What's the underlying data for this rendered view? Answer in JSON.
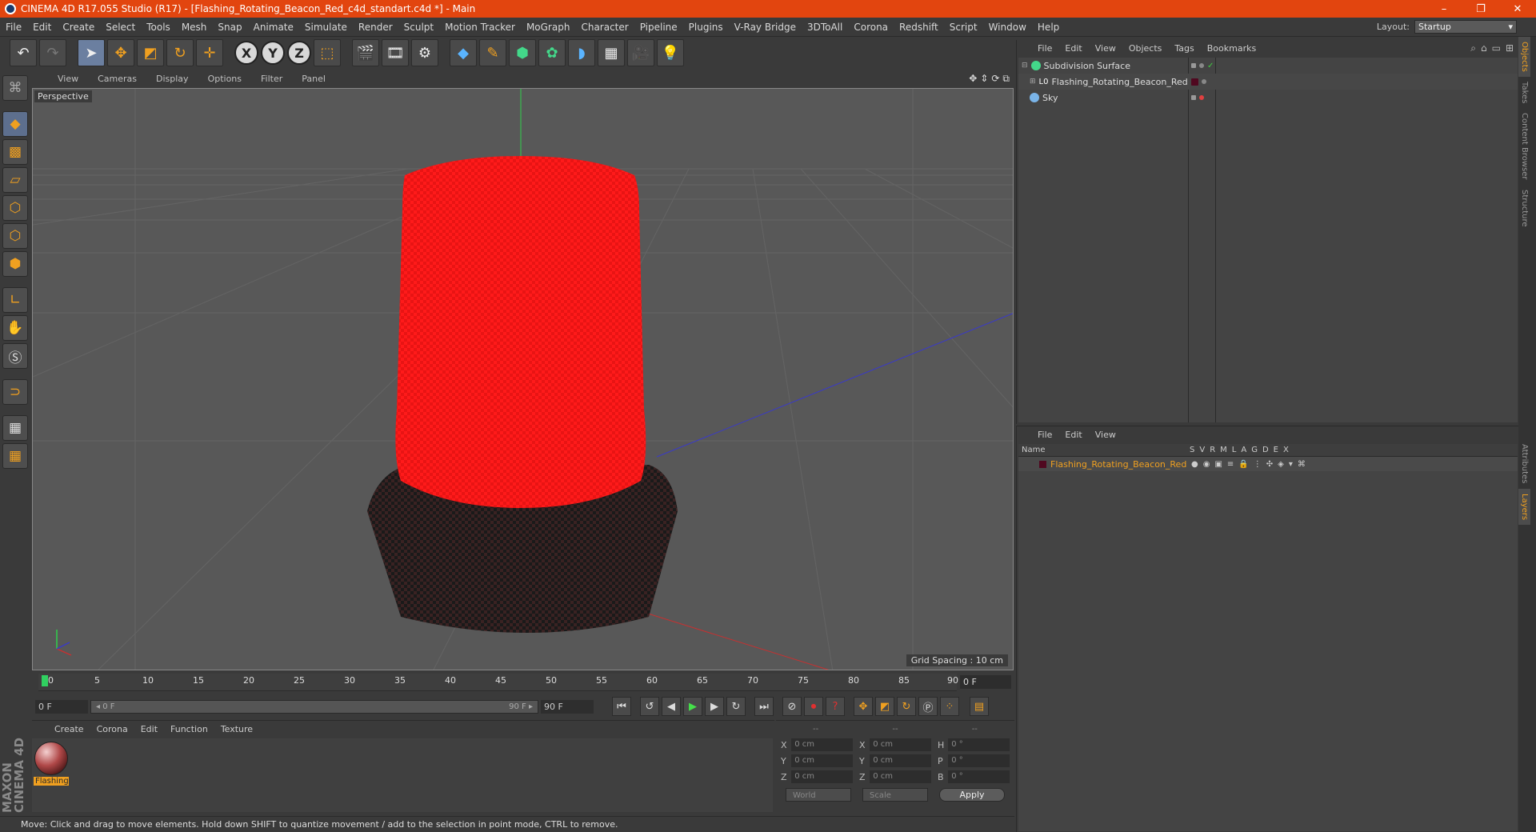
{
  "window": {
    "title": "CINEMA 4D R17.055 Studio (R17) - [Flashing_Rotating_Beacon_Red_c4d_standart.c4d *] - Main",
    "min": "–",
    "restore": "❐",
    "close": "✕"
  },
  "menu": [
    "File",
    "Edit",
    "Create",
    "Select",
    "Tools",
    "Mesh",
    "Snap",
    "Animate",
    "Simulate",
    "Render",
    "Sculpt",
    "Motion Tracker",
    "MoGraph",
    "Character",
    "Pipeline",
    "Plugins",
    "V-Ray Bridge",
    "3DToAll",
    "Corona",
    "Redshift",
    "Script",
    "Window",
    "Help"
  ],
  "layout": {
    "label": "Layout:",
    "value": "Startup"
  },
  "viewport": {
    "menu": [
      "View",
      "Cameras",
      "Display",
      "Options",
      "Filter",
      "Panel"
    ],
    "label": "Perspective",
    "grid_spacing": "Grid Spacing : 10 cm"
  },
  "timeline": {
    "ticks": [
      "0",
      "5",
      "10",
      "15",
      "20",
      "25",
      "30",
      "35",
      "40",
      "45",
      "50",
      "55",
      "60",
      "65",
      "70",
      "75",
      "80",
      "85",
      "90"
    ],
    "current": "0 F"
  },
  "transport": {
    "start": "0 F",
    "slider_left": "◂ 0 F",
    "slider_right": "90 F ▸",
    "end": "90 F"
  },
  "materials": {
    "menu": [
      "Create",
      "Corona",
      "Edit",
      "Function",
      "Texture"
    ],
    "items": [
      {
        "label": "Flashing"
      }
    ]
  },
  "coords": {
    "head": [
      "--",
      "--",
      "--"
    ],
    "rows": [
      {
        "a": "X",
        "av": "0 cm",
        "b": "X",
        "bv": "0 cm",
        "c": "H",
        "cv": "0 °"
      },
      {
        "a": "Y",
        "av": "0 cm",
        "b": "Y",
        "bv": "0 cm",
        "c": "P",
        "cv": "0 °"
      },
      {
        "a": "Z",
        "av": "0 cm",
        "b": "Z",
        "bv": "0 cm",
        "c": "B",
        "cv": "0 °"
      }
    ],
    "world": "World",
    "scale": "Scale",
    "apply": "Apply"
  },
  "status": "Move: Click and drag to move elements. Hold down SHIFT to quantize movement / add to the selection in point mode, CTRL to remove.",
  "brand": "MAXON CINEMA 4D",
  "objects": {
    "menu": [
      "File",
      "Edit",
      "View",
      "Objects",
      "Tags",
      "Bookmarks"
    ],
    "rows": [
      {
        "name": "Subdivision Surface",
        "icon_color": "#43d88a"
      },
      {
        "name": "Flashing_Rotating_Beacon_Red",
        "icon_color": "#ffffff"
      },
      {
        "name": "Sky",
        "icon_color": "#7ab4e8"
      }
    ]
  },
  "layers": {
    "menu": [
      "File",
      "Edit",
      "View"
    ],
    "header": {
      "name": "Name",
      "cols": [
        "S",
        "V",
        "R",
        "M",
        "L",
        "A",
        "G",
        "D",
        "E",
        "X"
      ]
    },
    "rows": [
      {
        "name": "Flashing_Rotating_Beacon_Red"
      }
    ]
  },
  "right_tabs": [
    "Objects",
    "Takes",
    "Content Browser",
    "Structure",
    "Attributes",
    "Layers"
  ],
  "colors": {
    "accent": "#f0a020",
    "title_bar": "#e2450f",
    "beacon_red": "#ff1a1a"
  }
}
